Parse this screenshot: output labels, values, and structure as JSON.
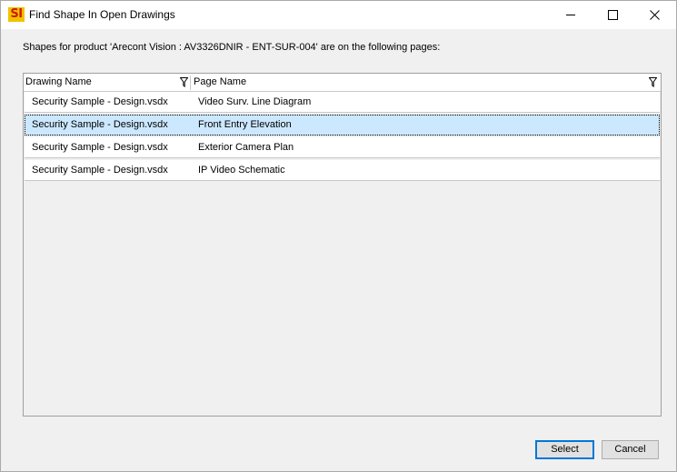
{
  "window": {
    "icon_text": "SI",
    "title": "Find Shape In Open Drawings",
    "controls": {
      "minimize_icon": "minimize-icon",
      "maximize_icon": "maximize-icon",
      "close_icon": "close-icon"
    }
  },
  "message": "Shapes for product 'Arecont Vision : AV3326DNIR - ENT-SUR-004' are on the following pages:",
  "grid": {
    "columns": [
      {
        "label": "Drawing Name",
        "icon": "filter-icon"
      },
      {
        "label": "Page Name",
        "icon": "filter-icon"
      }
    ],
    "rows": [
      {
        "drawing": "Security Sample - Design.vsdx",
        "page": "Video Surv. Line Diagram",
        "selected": false
      },
      {
        "drawing": "Security Sample - Design.vsdx",
        "page": "Front Entry Elevation",
        "selected": true
      },
      {
        "drawing": "Security Sample - Design.vsdx",
        "page": "Exterior Camera Plan",
        "selected": false
      },
      {
        "drawing": "Security Sample - Design.vsdx",
        "page": "IP Video Schematic",
        "selected": false
      }
    ],
    "selected_color": "#cce8ff"
  },
  "buttons": {
    "select_label": "Select",
    "cancel_label": "Cancel",
    "default_accent": "#0078d7"
  }
}
